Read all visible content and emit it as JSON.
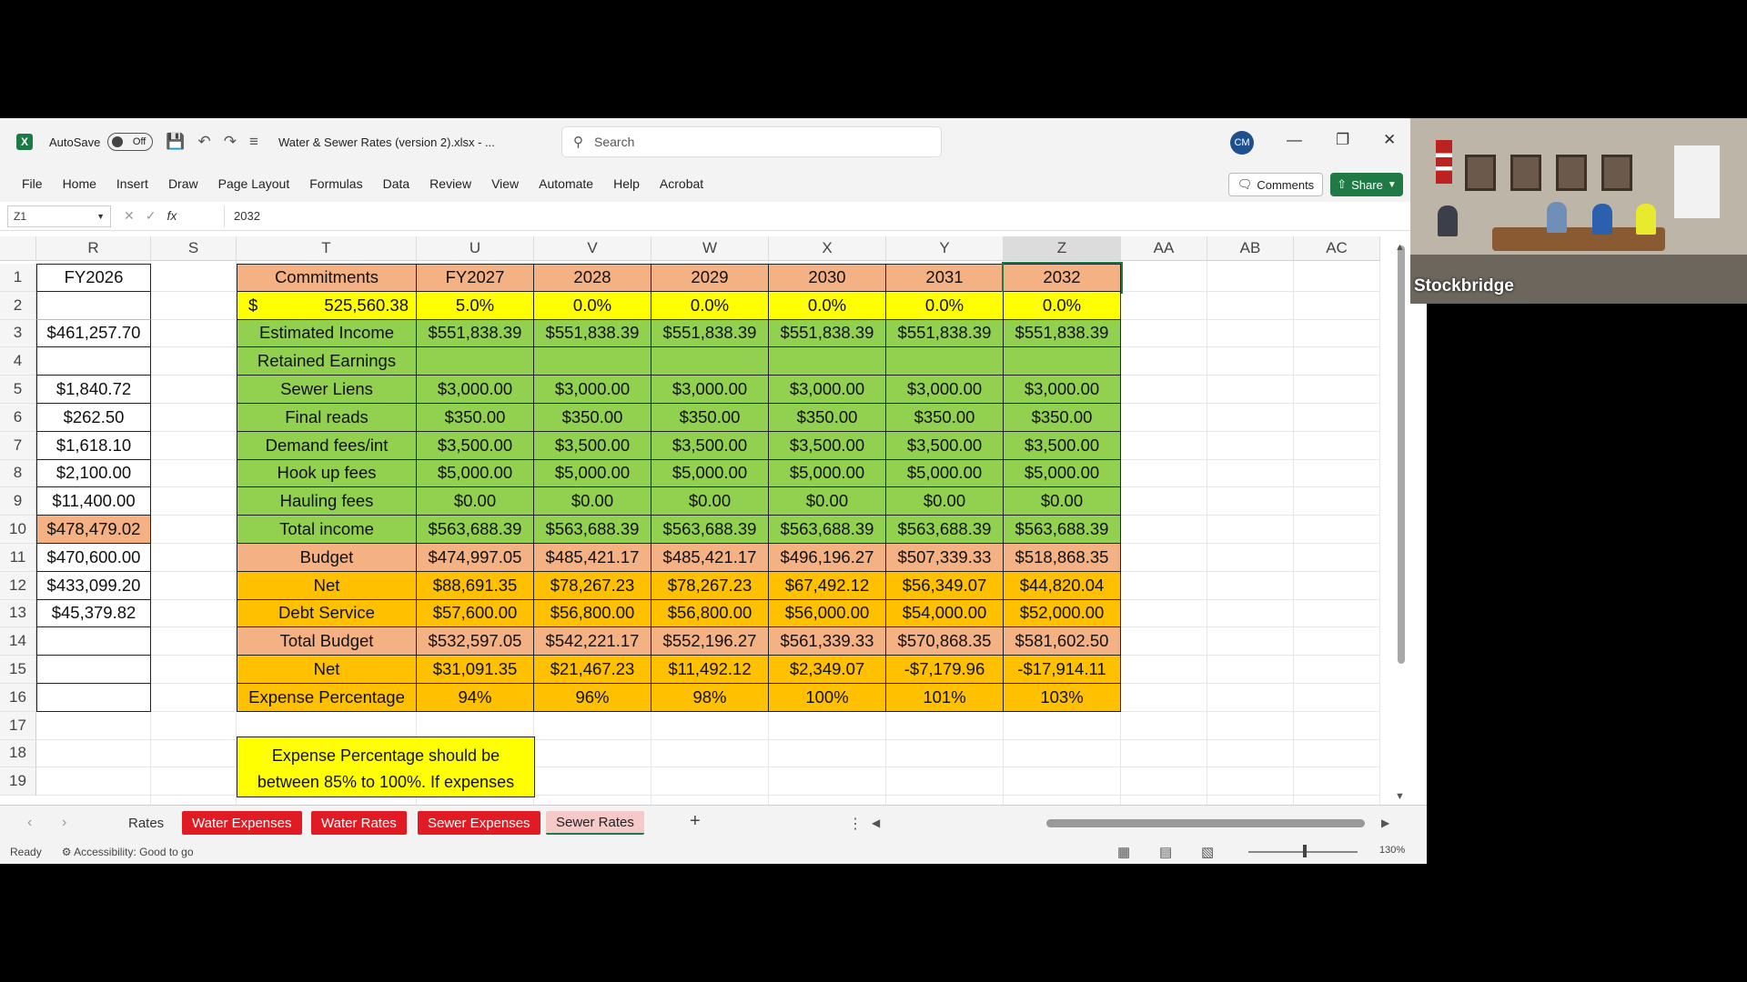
{
  "titlebar": {
    "autosave_label": "AutoSave",
    "autosave_state": "Off",
    "filename": "Water & Sewer Rates (version 2).xlsx - ...",
    "search_placeholder": "Search",
    "user_initials": "CM"
  },
  "menu": [
    "File",
    "Home",
    "Insert",
    "Draw",
    "Page Layout",
    "Formulas",
    "Data",
    "Review",
    "View",
    "Automate",
    "Help",
    "Acrobat"
  ],
  "actions": {
    "comments": "Comments",
    "share": "Share"
  },
  "formula_bar": {
    "cell_ref": "Z1",
    "value": "2032",
    "fx": "fx"
  },
  "columns": [
    "R",
    "S",
    "T",
    "U",
    "V",
    "W",
    "X",
    "Y",
    "Z",
    "AA",
    "AB",
    "AC"
  ],
  "selected_column": "Z",
  "rows": [
    "1",
    "2",
    "3",
    "4",
    "5",
    "6",
    "7",
    "8",
    "9",
    "10",
    "11",
    "12",
    "13",
    "14",
    "15",
    "16",
    "17",
    "18",
    "19"
  ],
  "colors": {
    "salmon": "#f4b183",
    "yellow": "#ffff00",
    "green": "#92d050",
    "orange": "#ffc000",
    "sheet_tab_red": "#e01b24",
    "excel_green": "#1f7a45"
  },
  "col_r": [
    "FY2026",
    "",
    "$461,257.70",
    "",
    "$1,840.72",
    "$262.50",
    "$1,618.10",
    "$2,100.00",
    "$11,400.00",
    "$478,479.02",
    "$470,600.00",
    "$433,099.20",
    "$45,379.82",
    "",
    "",
    ""
  ],
  "table": {
    "labels": [
      "Commitments",
      "",
      "Estimated Income",
      "Retained Earnings",
      "Sewer Liens",
      "Final reads",
      "Demand fees/int",
      "Hook up fees",
      "Hauling fees",
      "Total income",
      "Budget",
      "Net",
      "Debt Service",
      "Total Budget",
      "Net",
      "Expense Percentage"
    ],
    "commitment_symbol": "$",
    "commitment_value": "525,560.38",
    "row_fills": [
      "salmon",
      "yellow",
      "green",
      "green",
      "green",
      "green",
      "green",
      "green",
      "green",
      "green",
      "salmon",
      "orange",
      "orange",
      "salmon",
      "orange",
      "orange"
    ],
    "values": [
      [
        "FY2027",
        "2028",
        "2029",
        "2030",
        "2031",
        "2032"
      ],
      [
        "5.0%",
        "0.0%",
        "0.0%",
        "0.0%",
        "0.0%",
        "0.0%"
      ],
      [
        "$551,838.39",
        "$551,838.39",
        "$551,838.39",
        "$551,838.39",
        "$551,838.39",
        "$551,838.39"
      ],
      [
        "",
        "",
        "",
        "",
        "",
        ""
      ],
      [
        "$3,000.00",
        "$3,000.00",
        "$3,000.00",
        "$3,000.00",
        "$3,000.00",
        "$3,000.00"
      ],
      [
        "$350.00",
        "$350.00",
        "$350.00",
        "$350.00",
        "$350.00",
        "$350.00"
      ],
      [
        "$3,500.00",
        "$3,500.00",
        "$3,500.00",
        "$3,500.00",
        "$3,500.00",
        "$3,500.00"
      ],
      [
        "$5,000.00",
        "$5,000.00",
        "$5,000.00",
        "$5,000.00",
        "$5,000.00",
        "$5,000.00"
      ],
      [
        "$0.00",
        "$0.00",
        "$0.00",
        "$0.00",
        "$0.00",
        "$0.00"
      ],
      [
        "$563,688.39",
        "$563,688.39",
        "$563,688.39",
        "$563,688.39",
        "$563,688.39",
        "$563,688.39"
      ],
      [
        "$474,997.05",
        "$485,421.17",
        "$485,421.17",
        "$496,196.27",
        "$507,339.33",
        "$518,868.35"
      ],
      [
        "$88,691.35",
        "$78,267.23",
        "$78,267.23",
        "$67,492.12",
        "$56,349.07",
        "$44,820.04"
      ],
      [
        "$57,600.00",
        "$56,800.00",
        "$56,800.00",
        "$56,000.00",
        "$54,000.00",
        "$52,000.00"
      ],
      [
        "$532,597.05",
        "$542,221.17",
        "$552,196.27",
        "$561,339.33",
        "$570,868.35",
        "$581,602.50"
      ],
      [
        "$31,091.35",
        "$21,467.23",
        "$11,492.12",
        "$2,349.07",
        "-$7,179.96",
        "-$17,914.11"
      ],
      [
        "94%",
        "96%",
        "98%",
        "100%",
        "101%",
        "103%"
      ]
    ]
  },
  "note_lines": [
    "Expense Percentage should be",
    "between 85% to 100%.  If expenses"
  ],
  "sheet_tabs": [
    {
      "label": "Rates",
      "style": "plain"
    },
    {
      "label": "Water Expenses",
      "style": "red"
    },
    {
      "label": "Water Rates",
      "style": "red"
    },
    {
      "label": "Sewer Expenses",
      "style": "red"
    },
    {
      "label": "Sewer Rates",
      "style": "active"
    }
  ],
  "status": {
    "ready": "Ready",
    "accessibility": "Accessibility: Good to go",
    "zoom": "130%"
  },
  "video": {
    "label": "Stockbridge"
  }
}
